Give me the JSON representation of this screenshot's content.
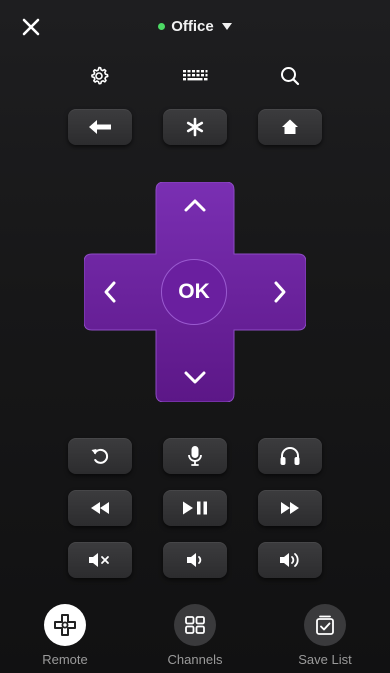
{
  "header": {
    "device_name": "Office",
    "device_status_color": "#4cd964"
  },
  "dpad": {
    "ok_label": "OK",
    "color": "#6a1e9c"
  },
  "top_icons": [
    "gear-icon",
    "keyboard-icon",
    "search-icon"
  ],
  "bottom_nav": {
    "remote_label": "Remote",
    "channels_label": "Channels",
    "save_list_label": "Save List"
  }
}
